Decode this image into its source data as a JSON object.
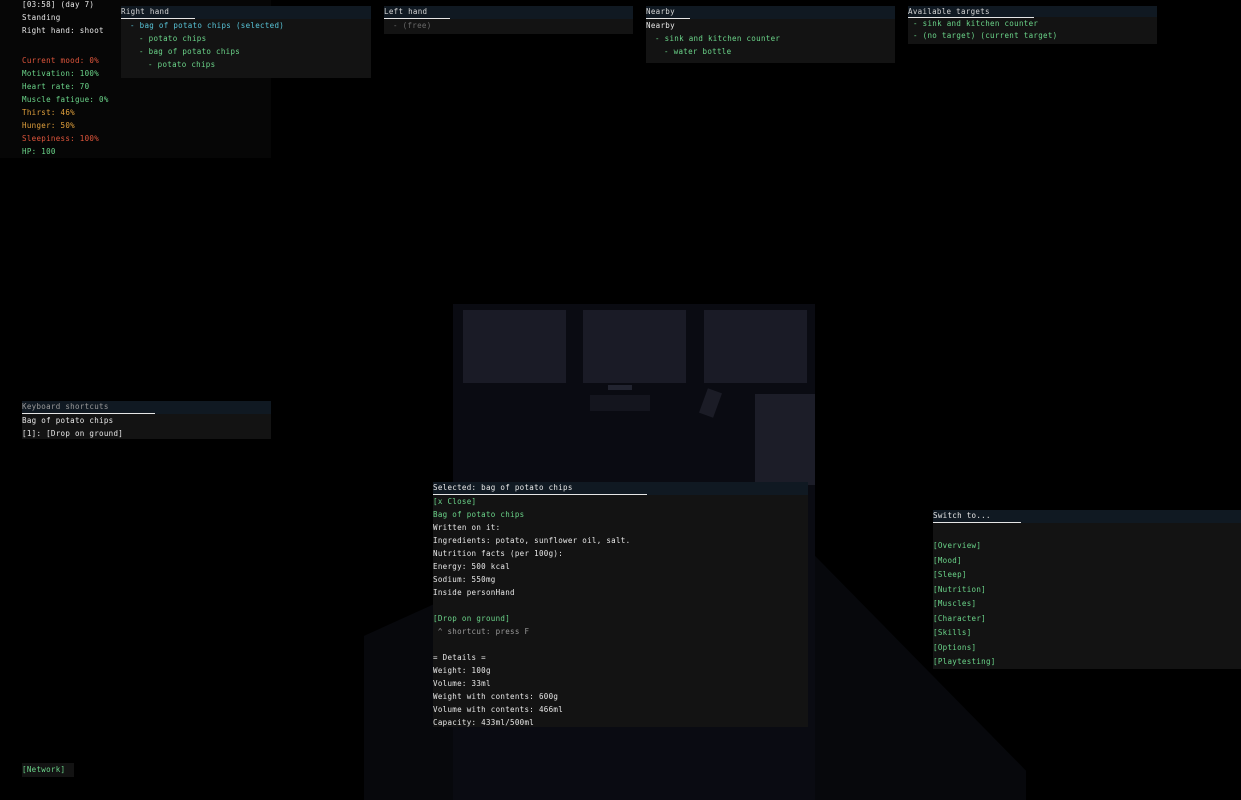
{
  "status": {
    "time": "[03:58] (day 7)",
    "posture": "Standing",
    "right_hand": "Right hand: shoot"
  },
  "stats": [
    {
      "label": "Current mood: 0%",
      "color": "#e0563c"
    },
    {
      "label": "Motivation: 100%",
      "color": "#6bd58a"
    },
    {
      "label": "Heart rate: 70",
      "color": "#6bd58a"
    },
    {
      "label": "Muscle fatigue: 0%",
      "color": "#6bd58a"
    },
    {
      "label": "Thirst: 46%",
      "color": "#e0a03c"
    },
    {
      "label": "Hunger: 50%",
      "color": "#e0a03c"
    },
    {
      "label": "Sleepiness: 100%",
      "color": "#e0563c"
    },
    {
      "label": "HP: 100",
      "color": "#6bd58a"
    }
  ],
  "right_hand_panel": {
    "title": "Right hand",
    "items": [
      "- bag of potato chips (selected)",
      "- potato chips",
      "- bag of potato chips",
      "- potato chips"
    ]
  },
  "left_hand_panel": {
    "title": "Left hand",
    "items": [
      "- (free)"
    ]
  },
  "nearby_panel": {
    "title": "Nearby",
    "subtitle": "Nearby",
    "items": [
      "- sink and kitchen counter",
      "- water bottle"
    ]
  },
  "targets_panel": {
    "title": "Available targets",
    "items": [
      "- sink and kitchen counter",
      "- (no target) (current target)"
    ]
  },
  "shortcuts_panel": {
    "title": "Keyboard shortcuts",
    "item_name": "Bag of potato chips",
    "shortcut": "[1]: [Drop on ground]"
  },
  "selected_panel": {
    "title": "Selected: bag of potato chips",
    "close": "[x Close]",
    "name": "Bag of potato chips",
    "lines": [
      "Written on it:",
      "Ingredients: potato, sunflower oil, salt.",
      "Nutrition facts (per 100g):",
      "Energy: 500 kcal",
      "Sodium: 550mg",
      "Inside personHand"
    ],
    "action": "[Drop on ground]",
    "action_hint": " ^ shortcut: press F",
    "details_header": "= Details =",
    "details": [
      "Weight: 100g",
      "Volume: 33ml",
      "Weight with contents: 600g",
      "Volume with contents: 466ml",
      "Capacity: 433ml/500ml"
    ]
  },
  "switch_panel": {
    "title": "Switch to...",
    "items": [
      "[Overview]",
      "[Mood]",
      "[Sleep]",
      "[Nutrition]",
      "[Muscles]",
      "[Character]",
      "[Skills]",
      "[Options]",
      "[Playtesting]"
    ]
  },
  "network_button": "[Network]"
}
